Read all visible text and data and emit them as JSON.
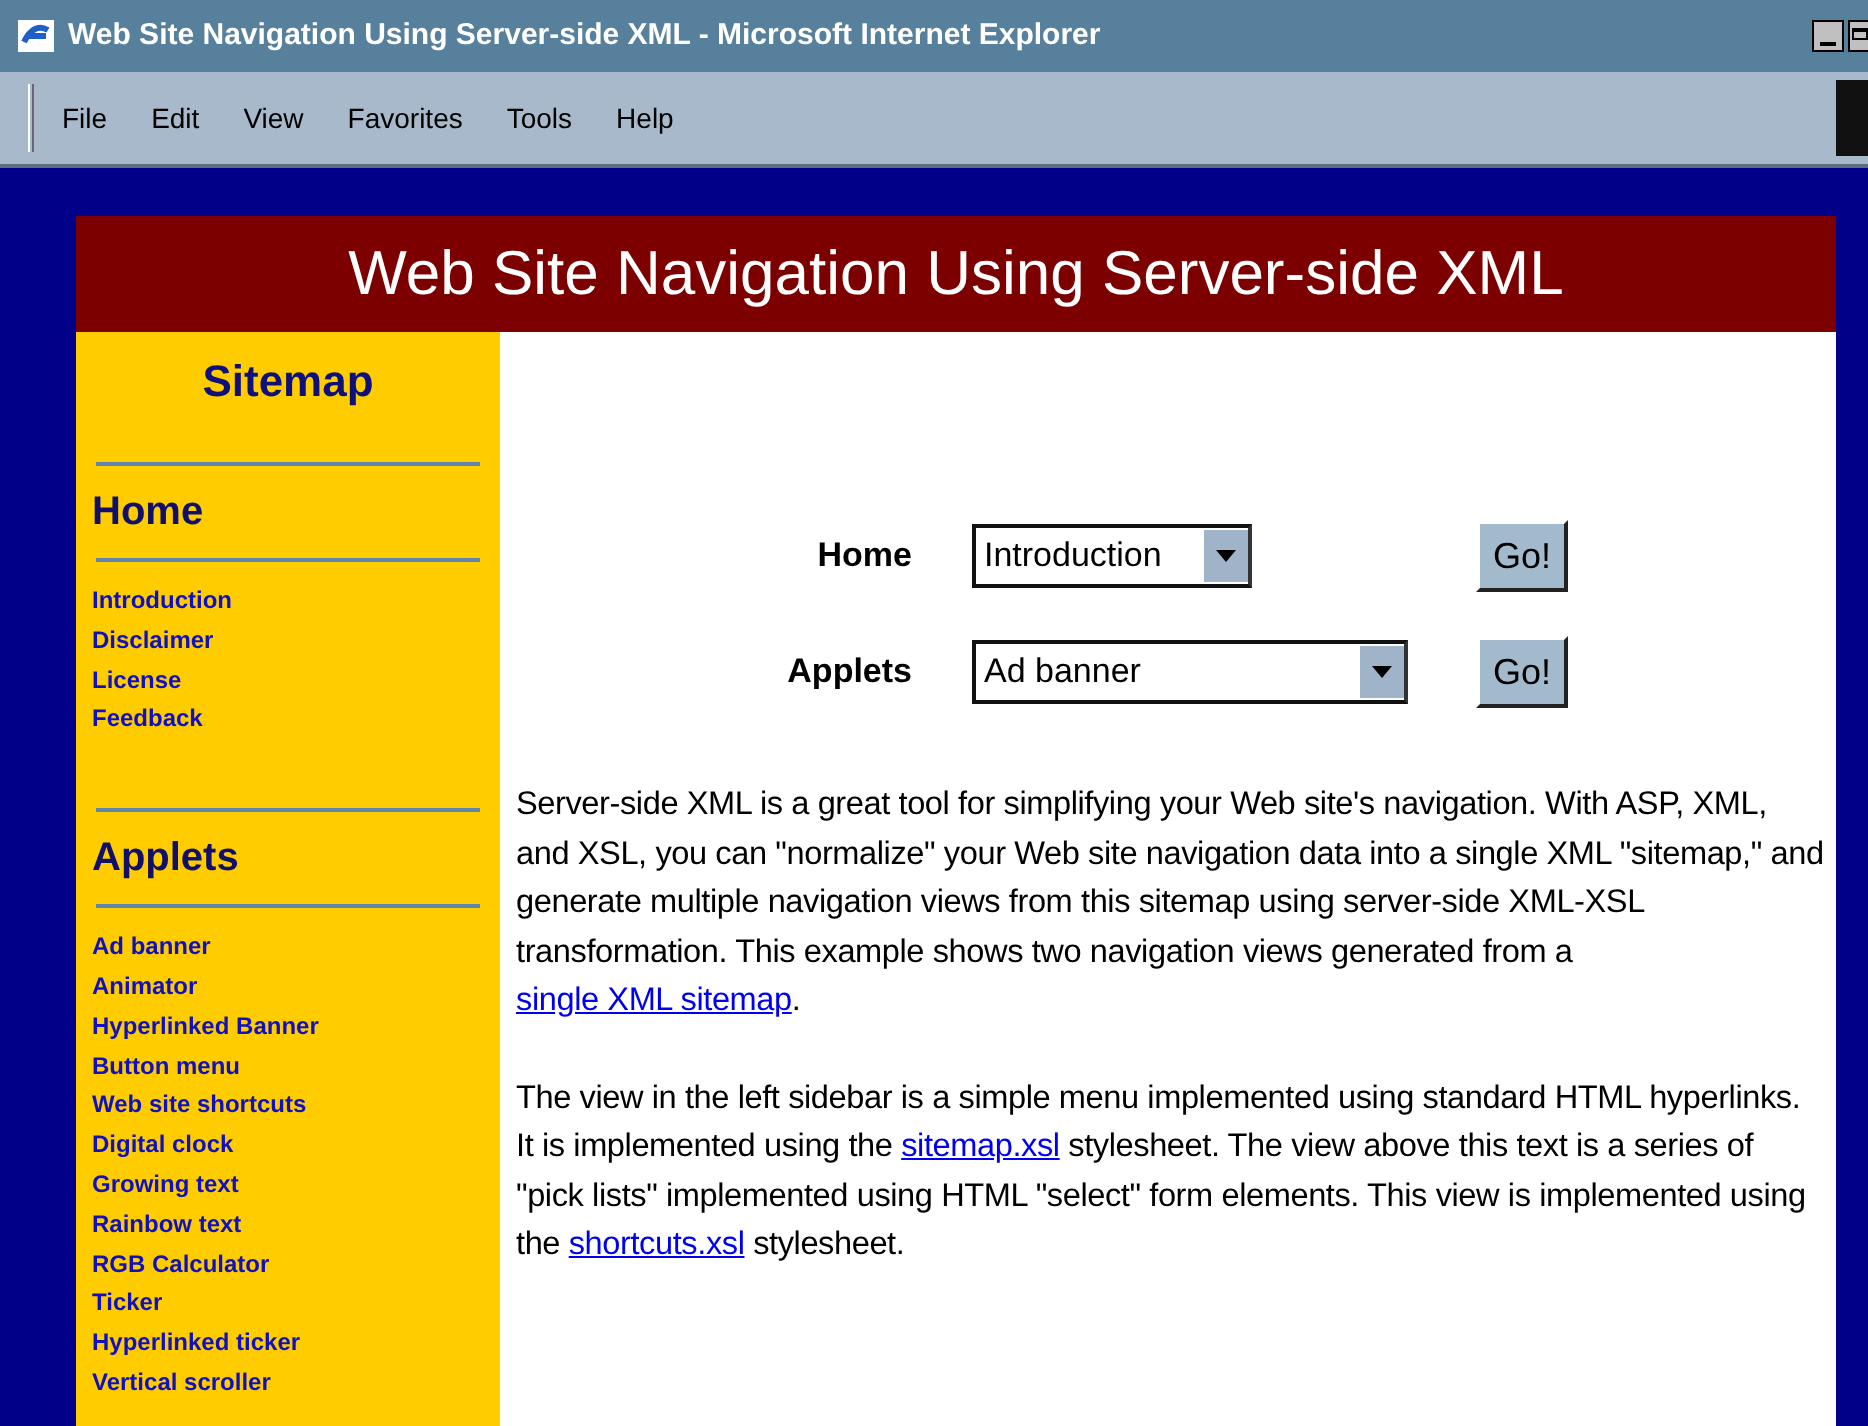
{
  "window": {
    "title": "Web Site Navigation Using Server-side XML - Microsoft Internet Explorer"
  },
  "menu_bar": [
    "File",
    "Edit",
    "View",
    "Favorites",
    "Tools",
    "Help"
  ],
  "page": {
    "heading": "Web Site Navigation Using Server-side XML",
    "sidebar": {
      "title": "Sitemap",
      "sections": [
        {
          "heading": "Home",
          "links": [
            "Introduction",
            "Disclaimer",
            "License",
            "Feedback"
          ]
        },
        {
          "heading": "Applets",
          "links": [
            "Ad banner",
            "Animator",
            "Hyperlinked Banner",
            "Button menu",
            "Web site shortcuts",
            "Digital clock",
            "Growing text",
            "Rainbow text",
            "RGB Calculator",
            "Ticker",
            "Hyperlinked ticker",
            "Vertical scroller"
          ]
        }
      ]
    },
    "pick_lists": [
      {
        "label": "Home",
        "value": "Introduction",
        "button": "Go!"
      },
      {
        "label": "Applets",
        "value": "Ad banner",
        "button": "Go!"
      }
    ],
    "paragraphs": [
      [
        {
          "text": "Server-side XML is a great tool for simplifying your Web site's navigation. With ASP, XML, and XSL, you can \"normalize\" your Web site navigation data into a single XML \"sitemap,\" and generate multiple navigation views from this sitemap using server-side XML-XSL transformation. This example shows two navigation views generated from a "
        },
        {
          "text": "single XML sitemap",
          "link": true
        },
        {
          "text": "."
        }
      ],
      [
        {
          "text": "The view in the left sidebar is a simple menu implemented using standard HTML hyperlinks. It is implemented using the "
        },
        {
          "text": "sitemap.xsl",
          "link": true
        },
        {
          "text": " stylesheet. The view above this text is a series of \"pick lists\" implemented using HTML \"select\" form elements. This view is implemented using the "
        },
        {
          "text": "shortcuts.xsl",
          "link": true
        },
        {
          "text": " stylesheet."
        }
      ]
    ]
  }
}
